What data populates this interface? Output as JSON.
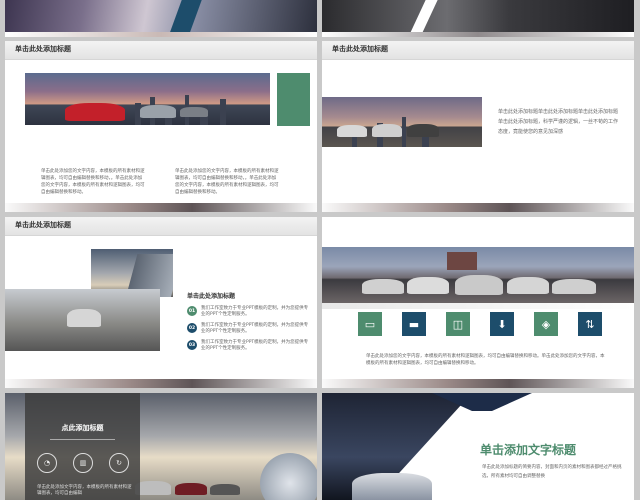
{
  "slides": [
    {
      "id": "top-left"
    },
    {
      "id": "top-right"
    },
    {
      "id": "s1",
      "title": "单击此处添加标题",
      "captions": [
        "单击此处添加您的文字内容，本模板的所有素材和逻辑图表，均可自由编辑替换和移动，。单击此处添加您的文字内容，本模板的所有素材和逻辑图表，均可自由编辑替换和移动。",
        "单击此处添加您的文字内容，本模板的所有素材和逻辑图表，均可自由编辑替换和移动，。单击此处添加您的文字内容，本模板的所有素材和逻辑图表，均可自由编辑替换和移动。"
      ],
      "accent": "#4e8c6e"
    },
    {
      "id": "s2",
      "title": "单击此处添加标题",
      "body": "单击此处添加标题单击此处添加标题单击此处添加标题单击此处添加标题，科学严谨的逻辑，一丝不苟的工作态度，竟能使您的意见加深感"
    },
    {
      "id": "s3",
      "title": "单击此处添加标题",
      "subtitle": "单击此处添加标题",
      "items": [
        {
          "num": "01",
          "text": "我们工作室致力于专业PPT模板的定制，并为您提供专业的PPT个性定制服务。"
        },
        {
          "num": "02",
          "text": "我们工作室致力于专业PPT模板的定制，并为您提供专业的PPT个性定制服务。"
        },
        {
          "num": "03",
          "text": "我们工作室致力于专业PPT模板的定制，并为您提供专业的PPT个性定制服务。"
        }
      ]
    },
    {
      "id": "s4",
      "icons": [
        {
          "name": "inbox-icon",
          "glyph": "▭",
          "color": "#4e8c6e"
        },
        {
          "name": "tray-icon",
          "glyph": "▬",
          "color": "#1d4d6b"
        },
        {
          "name": "box-icon",
          "glyph": "◫",
          "color": "#4e8c6e"
        },
        {
          "name": "download-icon",
          "glyph": "⬇",
          "color": "#1d4d6b"
        },
        {
          "name": "cube-icon",
          "glyph": "◈",
          "color": "#4e8c6e"
        },
        {
          "name": "transfer-icon",
          "glyph": "⇅",
          "color": "#1d4d6b"
        }
      ],
      "caption": "单击此处添加您的文字内容，本模板的所有素材和逻辑图表，均可自由编辑替换和移动。单击此处添加您的文字内容，本模板的所有素材和逻辑图表，均可自由编辑替换和移动。"
    },
    {
      "id": "s5",
      "title": "点此添加标题",
      "body": "单击此处添加文字内容，本模板的所有素材和逻辑图表，均可自由编辑"
    },
    {
      "id": "s6",
      "title": "单击添加文字标题",
      "body": "单击此处添加标题的简要内容，封面和内页的素材和图表都经过严格挑选，所有素材均可自由调整替换",
      "title_color": "#4e8c6e"
    }
  ]
}
